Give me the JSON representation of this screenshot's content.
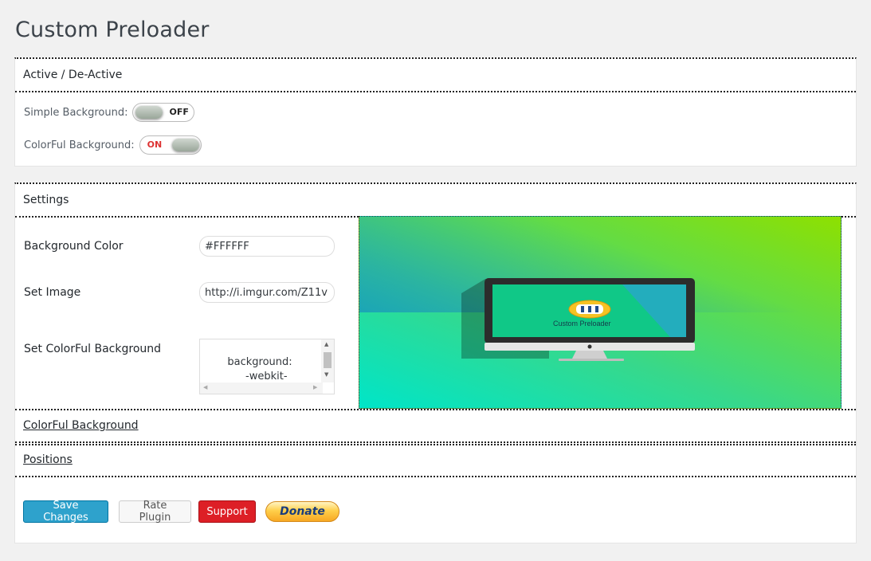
{
  "page_title": "Custom Preloader",
  "active_section": {
    "heading": "Active / De-Active",
    "simple_background": {
      "label": "Simple Background:",
      "state": "OFF"
    },
    "colorful_background": {
      "label": "ColorFul Background:",
      "state": "ON"
    }
  },
  "settings": {
    "heading": "Settings",
    "background_color": {
      "label": "Background Color",
      "value": "#FFFFFF"
    },
    "set_image": {
      "label": "Set Image",
      "value": "http://i.imgur.com/Z11v"
    },
    "colorful_background": {
      "label": "Set ColorFul Background",
      "value": "background:\n    -webkit-"
    },
    "preview_brand_text": "Custom Preloader"
  },
  "sections": {
    "colorful_background": "ColorFul Background",
    "positions": "Positions"
  },
  "buttons": {
    "save": "Save Changes",
    "rate": "Rate Plugin",
    "support": "Support",
    "donate": "Donate"
  },
  "colors": {
    "primary": "#2ea2cc",
    "support": "#dd1f26",
    "on_text": "#dd3333"
  }
}
